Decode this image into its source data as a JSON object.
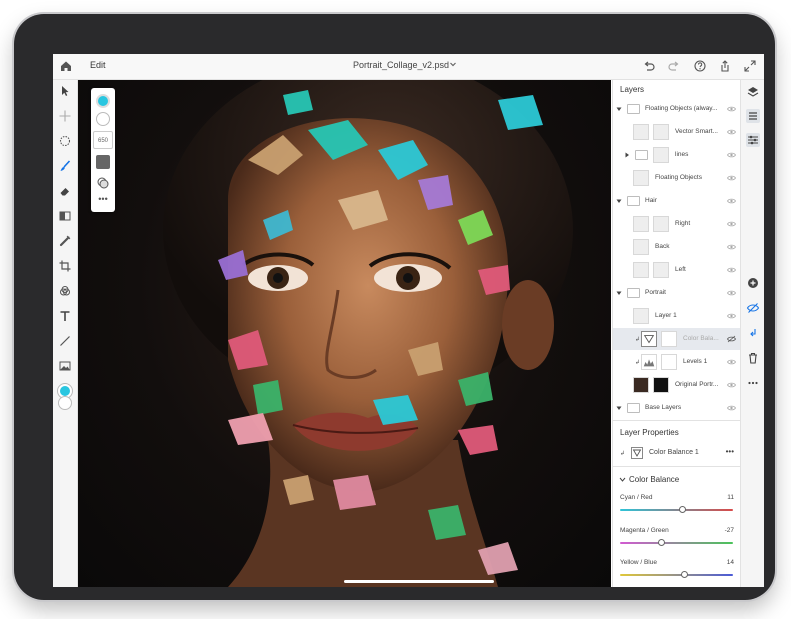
{
  "topbar": {
    "edit_label": "Edit",
    "document_title": "Portrait_Collage_v2.psd",
    "icons": [
      "home-icon",
      "chevron-down-icon",
      "undo-icon",
      "redo-icon",
      "help-icon",
      "share-icon",
      "fullscreen-icon"
    ]
  },
  "toolbar": {
    "tools": [
      "select-icon",
      "move-icon",
      "lasso-icon",
      "brush-icon",
      "eraser-icon",
      "gradient-icon",
      "healing-icon",
      "crop-icon",
      "fill-icon",
      "type-icon",
      "line-icon",
      "image-icon",
      "color-swatch"
    ],
    "active_color": "#29c6e0"
  },
  "brush_panel": {
    "size_value": "650",
    "more_label": "•••",
    "color": "#29c6e0"
  },
  "layers": {
    "title": "Layers",
    "items": [
      {
        "name": "Floating Objects (alway...",
        "kind": "group",
        "expanded": true
      },
      {
        "name": "Vector Smart...",
        "kind": "layer"
      },
      {
        "name": "lines",
        "kind": "group",
        "expanded": false
      },
      {
        "name": "Floating Objects",
        "kind": "layer"
      },
      {
        "name": "Hair",
        "kind": "group",
        "expanded": true
      },
      {
        "name": "Right",
        "kind": "layer"
      },
      {
        "name": "Back",
        "kind": "layer"
      },
      {
        "name": "Left",
        "kind": "layer"
      },
      {
        "name": "Portrait",
        "kind": "group",
        "expanded": true
      },
      {
        "name": "Layer 1",
        "kind": "layer"
      },
      {
        "name": "Color Bala...",
        "kind": "adjustment",
        "selected": true
      },
      {
        "name": "Levels 1",
        "kind": "adjustment"
      },
      {
        "name": "Original Portr...",
        "kind": "layer"
      },
      {
        "name": "Base Layers",
        "kind": "group",
        "expanded": true
      }
    ]
  },
  "layer_properties": {
    "title": "Layer Properties",
    "layer_name": "Color Balance 1",
    "more_label": "•••"
  },
  "color_balance": {
    "title": "Color Balance",
    "sliders": [
      {
        "label": "Cyan / Red",
        "value": "11",
        "fraction": 0.555
      },
      {
        "label": "Magenta / Green",
        "value": "-27",
        "fraction": 0.365
      },
      {
        "label": "Yellow / Blue",
        "value": "14",
        "fraction": 0.57
      }
    ]
  },
  "strip": {
    "icons": [
      "layers-icon",
      "layer-stack-icon",
      "adjustments-icon",
      "add-icon",
      "visibility-icon",
      "clip-icon",
      "trash-icon",
      "more-icon"
    ]
  }
}
